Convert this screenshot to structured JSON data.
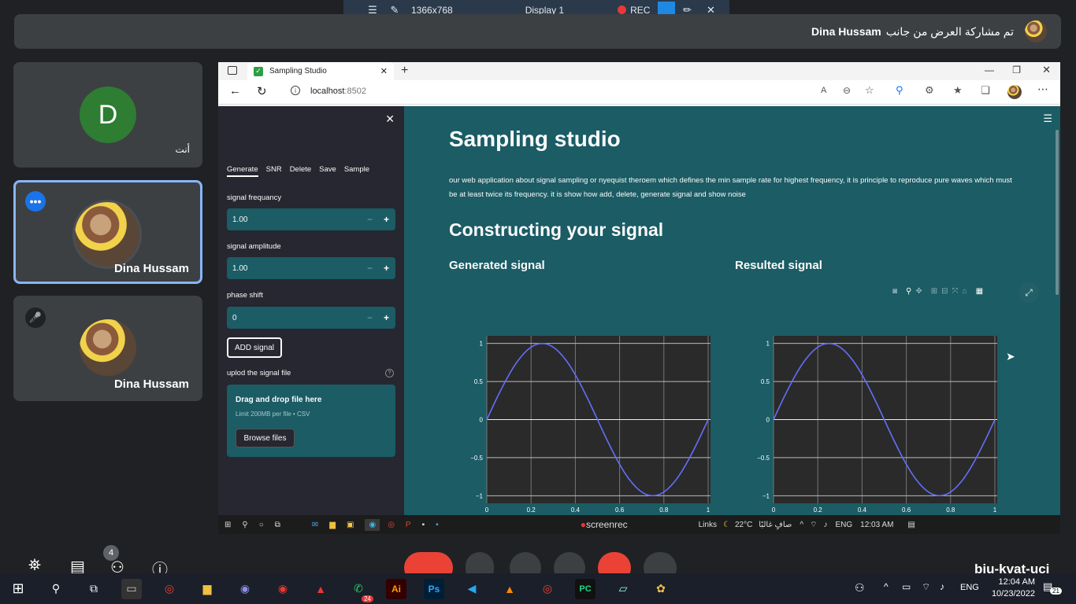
{
  "topbar": {
    "resolution": "1366x768",
    "display": "Display 1",
    "rec": "REC"
  },
  "share_banner": {
    "text": "تم مشاركة العرض من جانب",
    "presenter": "Dina Hussam"
  },
  "participants": [
    {
      "initial": "D",
      "label": "أنت",
      "color": "#2e7d32"
    },
    {
      "name": "Dina Hussam"
    },
    {
      "name": "Dina Hussam"
    }
  ],
  "browser": {
    "tab_title": "Sampling Studio",
    "url_host": "localhost",
    "url_port": ":8502"
  },
  "sidebar": {
    "tabs": [
      "Generate",
      "SNR",
      "Delete",
      "Save",
      "Sample"
    ],
    "fields": [
      {
        "label": "signal frequancy",
        "value": "1.00"
      },
      {
        "label": "signal amplitude",
        "value": "1.00"
      },
      {
        "label": "phase shift",
        "value": "0"
      }
    ],
    "add_button": "ADD signal",
    "upload_label": "uplod the signal file",
    "dropzone_title": "Drag and drop file here",
    "dropzone_limit": "Limit 200MB per file • CSV",
    "browse_button": "Browse files"
  },
  "main": {
    "title": "Sampling studio",
    "description": "our web application about signal sampling or nyequist theroem which defines the min sample rate for highest frequency, it is principle to reproduce pure waves which must be at least twice its frequency. it is show how add, delete, generate signal and show noise",
    "section_title": "Constructing your signal",
    "left_subtitle": "Generated signal",
    "right_subtitle": "Resulted signal"
  },
  "chart_data": [
    {
      "type": "line",
      "title": "Generated signal",
      "x": [
        0,
        0.05,
        0.1,
        0.15,
        0.2,
        0.25,
        0.3,
        0.35,
        0.4,
        0.45,
        0.5,
        0.55,
        0.6,
        0.65,
        0.7,
        0.75,
        0.8,
        0.85,
        0.9,
        0.95,
        1.0
      ],
      "y": [
        0,
        0.309,
        0.588,
        0.809,
        0.951,
        1,
        0.951,
        0.809,
        0.588,
        0.309,
        0,
        -0.309,
        -0.588,
        -0.809,
        -0.951,
        -1,
        -0.951,
        -0.809,
        -0.588,
        -0.309,
        0
      ],
      "xticks": [
        "0",
        "0.2",
        "0.4",
        "0.6",
        "0.8",
        "1"
      ],
      "yticks": [
        "1",
        "0.5",
        "0",
        "−0.5",
        "−1"
      ],
      "xlim": [
        0,
        1
      ],
      "ylim": [
        -1.1,
        1.1
      ],
      "color": "#636efa",
      "grid": true
    },
    {
      "type": "line",
      "title": "Resulted signal",
      "x": [
        0,
        0.05,
        0.1,
        0.15,
        0.2,
        0.25,
        0.3,
        0.35,
        0.4,
        0.45,
        0.5,
        0.55,
        0.6,
        0.65,
        0.7,
        0.75,
        0.8,
        0.85,
        0.9,
        0.95,
        1.0
      ],
      "y": [
        0,
        0.309,
        0.588,
        0.809,
        0.951,
        1,
        0.951,
        0.809,
        0.588,
        0.309,
        0,
        -0.309,
        -0.588,
        -0.809,
        -0.951,
        -1,
        -0.951,
        -0.809,
        -0.588,
        -0.309,
        0
      ],
      "xticks": [
        "0",
        "0.2",
        "0.4",
        "0.6",
        "0.8",
        "1"
      ],
      "yticks": [
        "1",
        "0.5",
        "0",
        "−0.5",
        "−1"
      ],
      "xlim": [
        0,
        1
      ],
      "ylim": [
        -1.1,
        1.1
      ],
      "color": "#636efa",
      "grid": true
    }
  ],
  "inner_taskbar": {
    "links": "Links",
    "temp": "22°C",
    "weather": "صافٍ غالبًا",
    "lang": "ENG",
    "time": "12:03 AM",
    "recorder": "screenrec"
  },
  "meet": {
    "participant_count": "4",
    "room": "biu-kvat-uci"
  },
  "win_taskbar": {
    "lang": "ENG",
    "time": "12:04 AM",
    "date": "10/23/2022",
    "notif": "21",
    "whatsapp_badge": "24"
  }
}
